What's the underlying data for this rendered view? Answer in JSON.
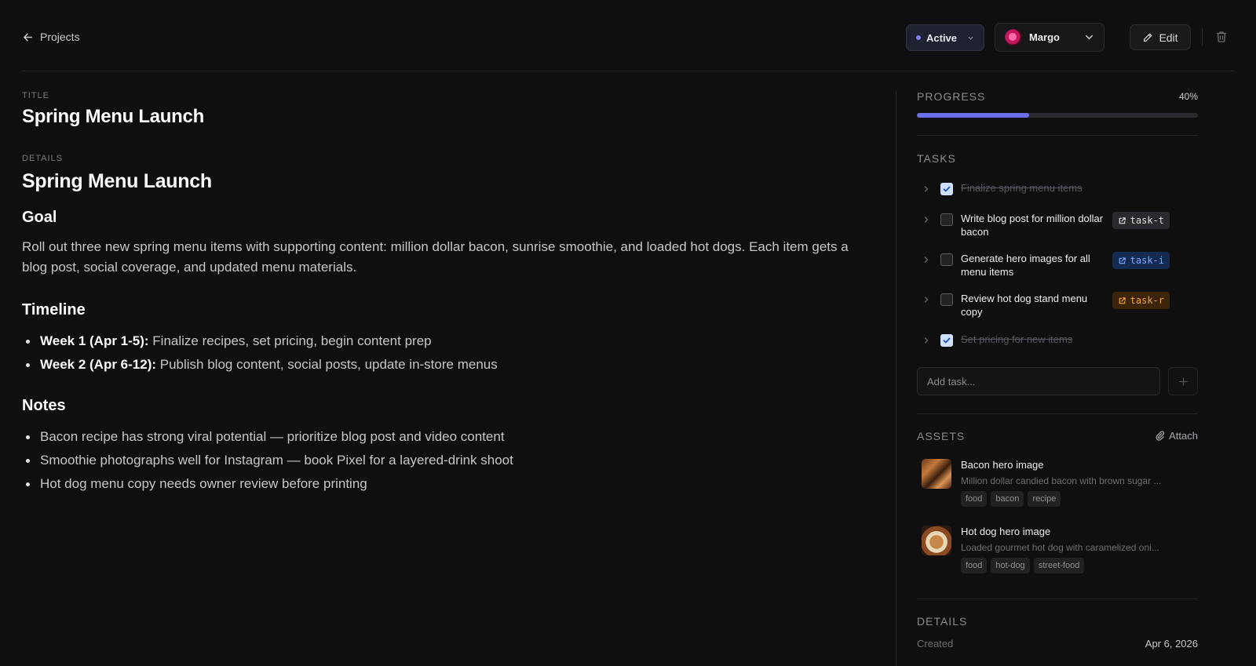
{
  "header": {
    "back_label": "Projects",
    "status_label": "Active",
    "user_name": "Margo",
    "edit_label": "Edit"
  },
  "main": {
    "title_label": "TITLE",
    "title": "Spring Menu Launch",
    "details_label": "DETAILS",
    "doc_heading": "Spring Menu Launch",
    "goal_heading": "Goal",
    "goal_text": "Roll out three new spring menu items with supporting content: million dollar bacon, sunrise smoothie, and loaded hot dogs. Each item gets a blog post, social coverage, and updated menu materials.",
    "timeline_heading": "Timeline",
    "timeline": [
      {
        "label": "Week 1 (Apr 1-5):",
        "text": "Finalize recipes, set pricing, begin content prep"
      },
      {
        "label": "Week 2 (Apr 6-12):",
        "text": "Publish blog content, social posts, update in-store menus"
      }
    ],
    "notes_heading": "Notes",
    "notes": [
      "Bacon recipe has strong viral potential — prioritize blog post and video content",
      "Smoothie photographs well for Instagram — book Pixel for a layered-drink shoot",
      "Hot dog menu copy needs owner review before printing"
    ]
  },
  "sidebar": {
    "progress_label": "PROGRESS",
    "progress_text": "40%",
    "progress_value": 0.4,
    "tasks_label": "TASKS",
    "tasks": [
      {
        "text": "Finalize spring menu items",
        "done": true,
        "tag": ""
      },
      {
        "text": "Write blog post for million dollar bacon",
        "done": false,
        "tag": "task-t"
      },
      {
        "text": "Generate hero images for all menu items",
        "done": false,
        "tag": "task-i"
      },
      {
        "text": "Review hot dog stand menu copy",
        "done": false,
        "tag": "task-r"
      },
      {
        "text": "Set pricing for new items",
        "done": true,
        "tag": ""
      }
    ],
    "add_task_placeholder": "Add task...",
    "assets_label": "ASSETS",
    "attach_label": "Attach",
    "assets": [
      {
        "name": "Bacon hero image",
        "desc": "Million dollar candied bacon with brown sugar ...",
        "tags": [
          "food",
          "bacon",
          "recipe"
        ]
      },
      {
        "name": "Hot dog hero image",
        "desc": "Loaded gourmet hot dog with caramelized oni...",
        "tags": [
          "food",
          "hot-dog",
          "street-food"
        ]
      }
    ],
    "details_label": "DETAILS",
    "created_label": "Created",
    "created_value": "Apr 6, 2026"
  },
  "colors": {
    "background": "#0f0f10",
    "accent": "#6a6ee8",
    "status_dot": "#7f7ff0",
    "tag_info": "#7fa9ff",
    "tag_warn": "#f0a53a"
  },
  "icons": {
    "back": "arrow-left-icon",
    "status": "chevron-down-icon",
    "user": "chevron-down-icon",
    "edit": "pencil-icon",
    "delete": "trash-icon",
    "expand": "chevron-right-icon",
    "tag": "external-link-icon",
    "add": "plus-icon",
    "attach": "paperclip-icon"
  }
}
